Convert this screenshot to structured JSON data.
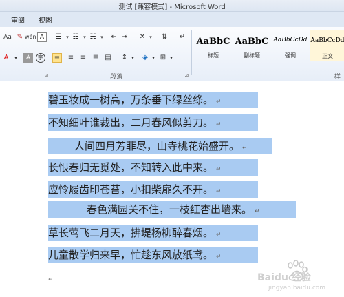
{
  "window": {
    "title": "测试 [兼容模式] - Microsoft Word"
  },
  "tabs": [
    "审阅",
    "视图"
  ],
  "ribbon": {
    "paragraph_group_label": "段落",
    "styles_group_label_partial": "样",
    "styles": [
      {
        "sample": "AaBbC",
        "name": "标题"
      },
      {
        "sample": "AaBbC",
        "name": "副标题"
      },
      {
        "sample": "AaBbCcDd",
        "name": "强调"
      },
      {
        "sample": "AaBbCcDd",
        "name": "正文",
        "selected": true
      }
    ]
  },
  "document": {
    "lines": [
      "碧玉妆成一树高，万条垂下绿丝绦。",
      "不知细叶谁裁出，二月春风似剪刀。",
      "人间四月芳菲尽，山寺桃花始盛开。",
      "长恨春归无觅处，不知转入此中来。",
      "应怜屐齿印苍苔，小扣柴扉久不开。",
      "春色满园关不住，一枝红杏出墙来。",
      "草长莺飞二月天，拂堤杨柳醉春烟。",
      "儿童散学归来早，忙趁东风放纸鸢。"
    ],
    "paragraph_mark": "↵"
  },
  "watermark": {
    "text": "Baidu 经验",
    "url": "jingyan.baidu.com"
  }
}
